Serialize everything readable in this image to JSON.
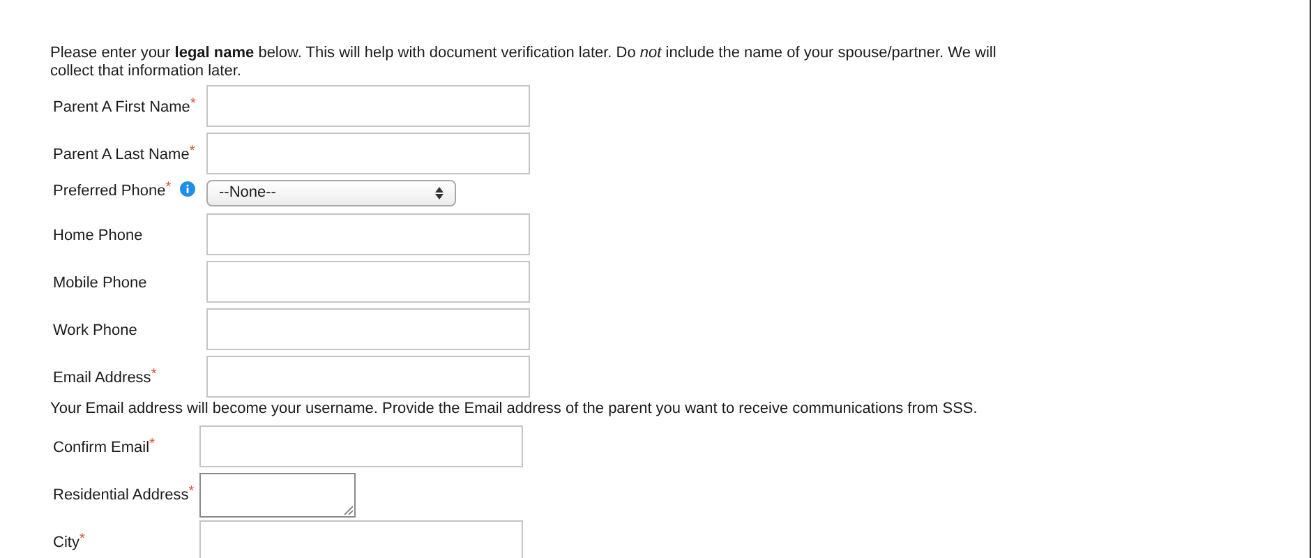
{
  "intro": "Please enter your **legal name** below. This will help with document verification later. Do *not* include the name of your spouse/partner. We will collect that information later.",
  "fields": [
    {
      "label": "Parent A First Name",
      "required_mark": "*",
      "kind": "text"
    },
    {
      "label": "Parent A Last Name",
      "required_mark": "*",
      "kind": "text"
    },
    {
      "label": "Preferred Phone",
      "required_mark": "*",
      "info": true,
      "kind": "select",
      "value": "--None--"
    },
    {
      "label": "Home Phone",
      "kind": "text"
    },
    {
      "label": "Mobile Phone",
      "kind": "text"
    },
    {
      "label": "Work Phone",
      "kind": "text"
    },
    {
      "label": "Email Address",
      "required_mark": "*",
      "kind": "text"
    }
  ],
  "note": "Your Email address will become your username. Provide the Email address of the parent you want to receive communications from SSS.",
  "fields2": [
    {
      "label": "Confirm Email",
      "required_mark": "*",
      "kind": "text"
    },
    {
      "label": "Residential Address",
      "required_mark": "*",
      "kind": "textarea"
    },
    {
      "label": "City",
      "required_mark": "*",
      "kind": "text"
    }
  ]
}
